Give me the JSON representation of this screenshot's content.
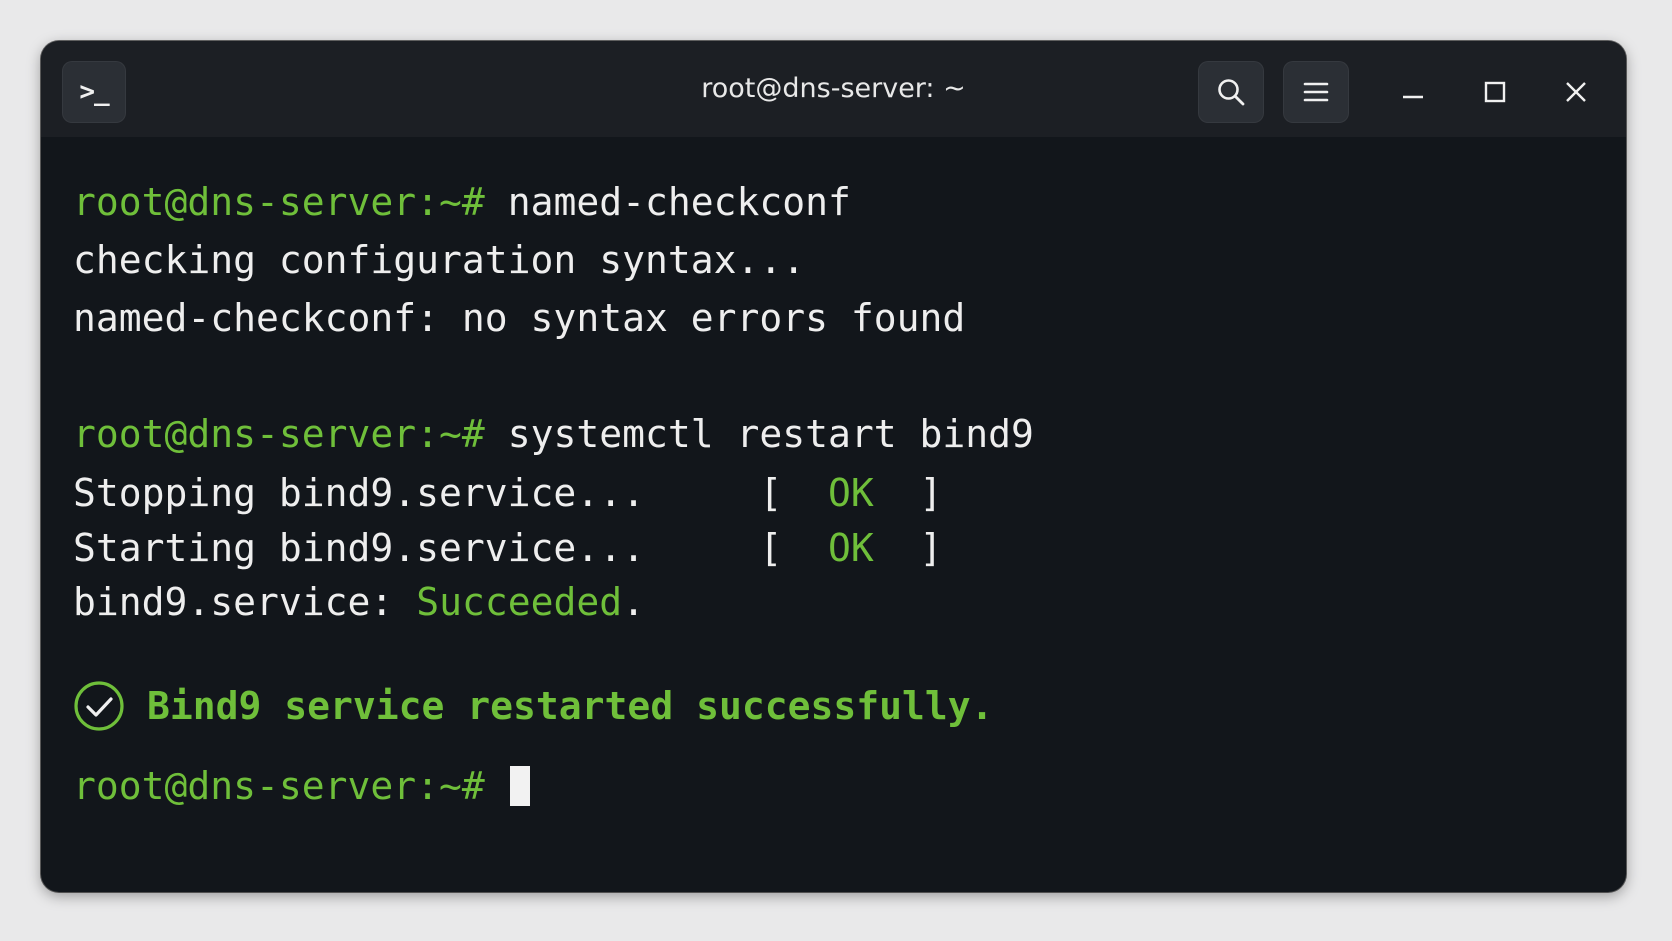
{
  "window": {
    "title": "root@dns-server: ~",
    "terminal_button_glyph": ">_",
    "icons": {
      "terminal": "terminal-icon",
      "search": "search-icon",
      "menu": "hamburger-menu-icon",
      "minimize": "minimize-icon",
      "maximize": "maximize-icon",
      "close": "close-icon"
    }
  },
  "colors": {
    "background": "#e9e9ea",
    "terminal_bg": "#12161b",
    "titlebar_bg": "#1c1f24",
    "prompt_green": "#6fbf3a",
    "text": "#eeeeee"
  },
  "terminal": {
    "prompt": "root@dns-server:~#",
    "line1": {
      "command": "named-checkconf"
    },
    "line2": "checking configuration syntax...",
    "line3": "named-checkconf: no syntax errors found",
    "line4": {
      "command": "systemctl restart bind9"
    },
    "line5": {
      "text": "Stopping bind9.service...",
      "open": "[",
      "status": "OK",
      "close": "]"
    },
    "line6": {
      "text": "Starting bind9.service...",
      "open": "[",
      "status": "OK",
      "close": "]"
    },
    "line7": {
      "label": "bind9.service:",
      "status": "Succeeded",
      "end": "."
    },
    "success_message": "Bind9 service restarted successfully.",
    "success_icon": "check-circle-icon",
    "final_prompt": "root@dns-server:~#"
  }
}
